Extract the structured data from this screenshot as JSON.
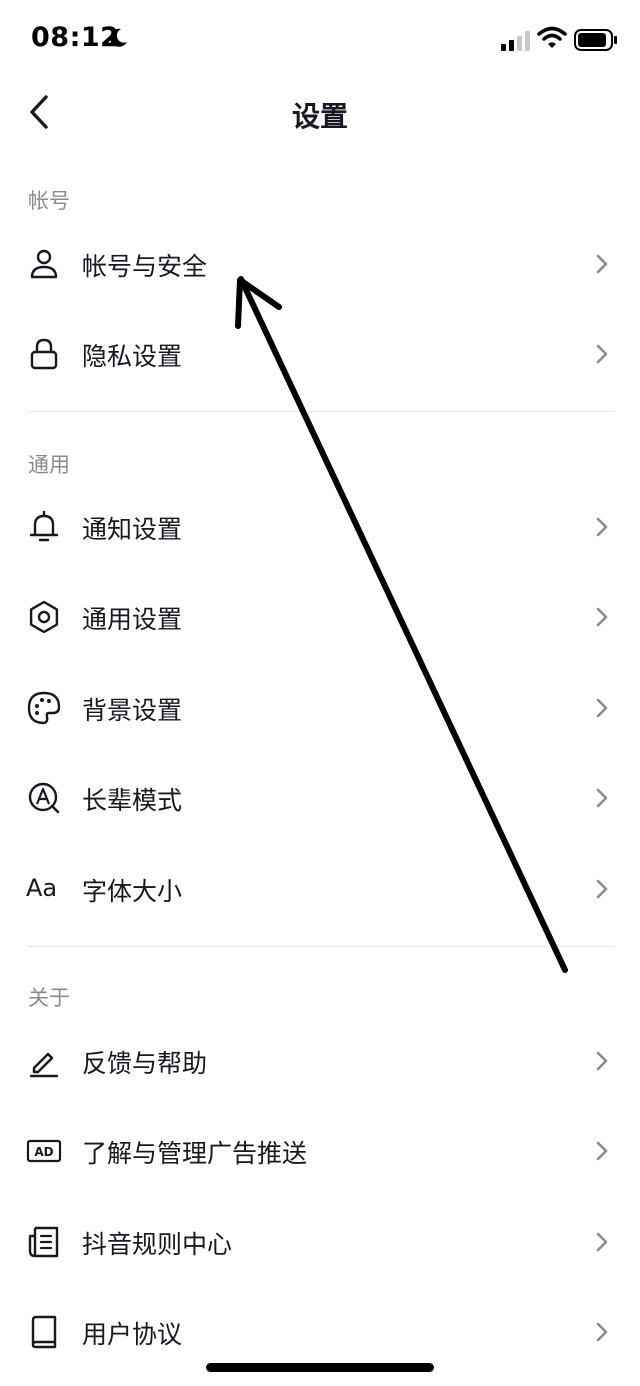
{
  "status_bar": {
    "time": "08:12"
  },
  "nav": {
    "title": "设置"
  },
  "sections": {
    "account": {
      "header": "帐号",
      "items": [
        {
          "label": "帐号与安全",
          "icon": "person-icon"
        },
        {
          "label": "隐私设置",
          "icon": "lock-icon"
        }
      ]
    },
    "general": {
      "header": "通用",
      "items": [
        {
          "label": "通知设置",
          "icon": "bell-icon"
        },
        {
          "label": "通用设置",
          "icon": "gear-icon"
        },
        {
          "label": "背景设置",
          "icon": "palette-icon"
        },
        {
          "label": "长辈模式",
          "icon": "elder-mode-icon"
        },
        {
          "label": "字体大小",
          "icon": "font-size-icon",
          "icon_text": "Aa"
        }
      ]
    },
    "about": {
      "header": "关于",
      "items": [
        {
          "label": "反馈与帮助",
          "icon": "pencil-icon"
        },
        {
          "label": "了解与管理广告推送",
          "icon": "ad-icon",
          "icon_text": "AD"
        },
        {
          "label": "抖音规则中心",
          "icon": "document-icon"
        },
        {
          "label": "用户协议",
          "icon": "book-icon"
        }
      ]
    }
  },
  "colors": {
    "text": "#161823",
    "secondary": "#8a8b91",
    "divider": "#e5e5e7",
    "annotation": "#000000"
  }
}
